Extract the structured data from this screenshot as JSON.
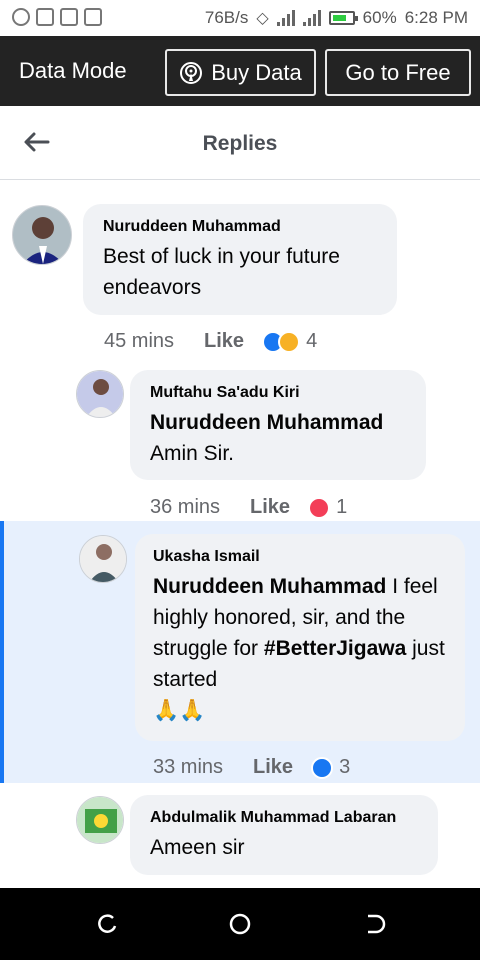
{
  "status_bar": {
    "speed": "76B/s",
    "battery": "60%",
    "time": "6:28 PM"
  },
  "data_bar": {
    "title": "Data Mode",
    "buy_label": "Buy Data",
    "free_label": "Go to Free"
  },
  "header": {
    "title": "Replies"
  },
  "comments": [
    {
      "author": "Nuruddeen Muhammad",
      "text": "Best of luck in your future endeavors",
      "time": "45 mins",
      "like_label": "Like",
      "reactions": [
        "like",
        "care"
      ],
      "count": "4"
    },
    {
      "author": "Muftahu Sa'adu Kiri",
      "tag": "Nuruddeen Muhammad",
      "text": "Amin Sir.",
      "time": "36 mins",
      "like_label": "Like",
      "reactions": [
        "love"
      ],
      "count": "1"
    },
    {
      "author": "Ukasha Ismail",
      "tag": "Nuruddeen Muhammad",
      "text_part1": " I feel highly honored, sir, and the struggle for ",
      "hashtag": "#BetterJigawa",
      "text_part2": " just started",
      "emoji": "🙏🙏",
      "time": "33 mins",
      "like_label": "Like",
      "reactions": [
        "like"
      ],
      "count": "3"
    },
    {
      "author": "Abdulmalik Muhammad Labaran",
      "text": "Ameen sir"
    }
  ],
  "colors": {
    "accent": "#1877f2",
    "bubble": "#f0f2f5",
    "highlight": "#e7f0fd",
    "data_bar": "#232323"
  }
}
